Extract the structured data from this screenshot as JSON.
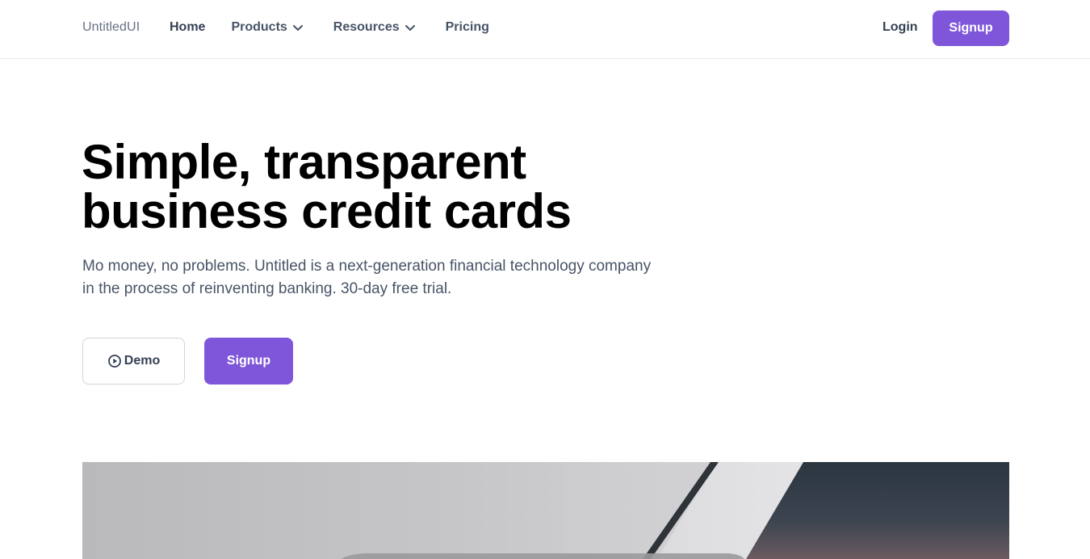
{
  "nav": {
    "brand": "UntitledUI",
    "links": [
      {
        "label": "Home"
      },
      {
        "label": "Products"
      },
      {
        "label": "Resources"
      },
      {
        "label": "Pricing"
      }
    ],
    "login_label": "Login",
    "signup_label": "Signup"
  },
  "hero": {
    "title": "Simple, transparent business credit cards",
    "subtitle": "Mo money, no problems. Untitled is a next-generation financial technology company in the process of reinventing banking. 30-day free trial.",
    "demo_label": "Demo",
    "signup_label": "Signup"
  },
  "colors": {
    "accent": "#7f56d9",
    "text_muted": "#475467",
    "heading": "#000000"
  },
  "icons": {
    "products_dropdown": "chevron-down-icon",
    "resources_dropdown": "chevron-down-icon",
    "demo": "play-circle-icon"
  }
}
